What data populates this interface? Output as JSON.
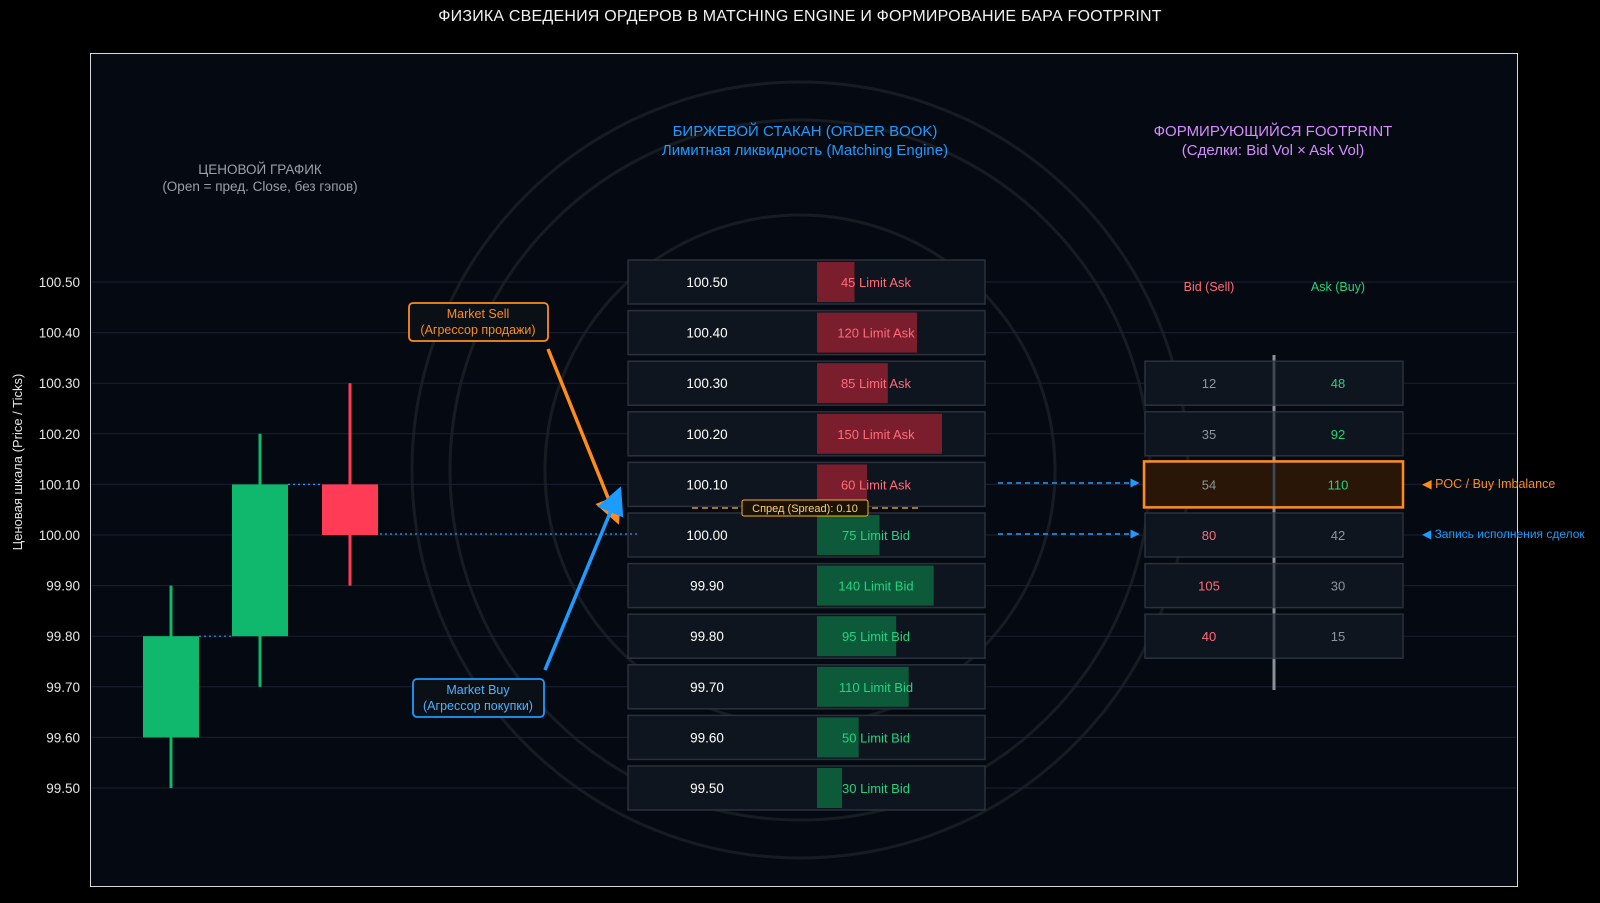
{
  "title": "ФИЗИКА СВЕДЕНИЯ ОРДЕРОВ В MATCHING ENGINE И ФОРМИРОВАНИЕ БАРА FOOTPRINT",
  "y_axis_label": "Ценовая шкала (Price / Ticks)",
  "price_levels": [
    "100.50",
    "100.40",
    "100.30",
    "100.20",
    "100.10",
    "100.00",
    "99.90",
    "99.80",
    "99.70",
    "99.60",
    "99.50"
  ],
  "price_chart": {
    "title": "ЦЕНОВОЙ ГРАФИК",
    "subtitle": "(Open = пред. Close, без гэпов)",
    "candles": [
      {
        "open": 99.6,
        "close": 99.8,
        "high": 99.9,
        "low": 99.5,
        "dir": "up"
      },
      {
        "open": 99.8,
        "close": 100.1,
        "high": 100.2,
        "low": 99.7,
        "dir": "up"
      },
      {
        "open": 100.1,
        "close": 100.0,
        "high": 100.3,
        "low": 99.9,
        "dir": "down"
      }
    ]
  },
  "order_book": {
    "title": "БИРЖЕВОЙ СТАКАН (ORDER BOOK)",
    "subtitle": "Лимитная ликвидность (Matching Engine)",
    "rows": [
      {
        "price": "100.50",
        "volume": 45,
        "label": "45 Limit Ask",
        "side": "ask"
      },
      {
        "price": "100.40",
        "volume": 120,
        "label": "120 Limit Ask",
        "side": "ask"
      },
      {
        "price": "100.30",
        "volume": 85,
        "label": "85 Limit Ask",
        "side": "ask"
      },
      {
        "price": "100.20",
        "volume": 150,
        "label": "150 Limit Ask",
        "side": "ask"
      },
      {
        "price": "100.10",
        "volume": 60,
        "label": "60 Limit Ask",
        "side": "ask"
      },
      {
        "price": "100.00",
        "volume": 75,
        "label": "75 Limit Bid",
        "side": "bid"
      },
      {
        "price": "99.90",
        "volume": 140,
        "label": "140 Limit Bid",
        "side": "bid"
      },
      {
        "price": "99.80",
        "volume": 95,
        "label": "95 Limit Bid",
        "side": "bid"
      },
      {
        "price": "99.70",
        "volume": 110,
        "label": "110 Limit Bid",
        "side": "bid"
      },
      {
        "price": "99.60",
        "volume": 50,
        "label": "50 Limit Bid",
        "side": "bid"
      },
      {
        "price": "99.50",
        "volume": 30,
        "label": "30 Limit Bid",
        "side": "bid"
      }
    ],
    "spread_label": "Спред (Spread): 0.10"
  },
  "aggressors": {
    "sell": {
      "line1": "Market Sell",
      "line2": "(Агрессор продажи)"
    },
    "buy": {
      "line1": "Market Buy",
      "line2": "(Агрессор покупки)"
    }
  },
  "footprint": {
    "title": "ФОРМИРУЮЩИЙСЯ FOOTPRINT",
    "subtitle": "(Сделки: Bid Vol × Ask Vol)",
    "bid_header": "Bid (Sell)",
    "ask_header": "Ask (Buy)",
    "rows": [
      {
        "price": "100.30",
        "bid": "12",
        "ask": "48",
        "bid_hl": false,
        "ask_hl": true
      },
      {
        "price": "100.20",
        "bid": "35",
        "ask": "92",
        "bid_hl": false,
        "ask_hl": true
      },
      {
        "price": "100.10",
        "bid": "54",
        "ask": "110",
        "bid_hl": false,
        "ask_hl": true,
        "poc": true
      },
      {
        "price": "100.00",
        "bid": "80",
        "ask": "42",
        "bid_hl": true,
        "ask_hl": false
      },
      {
        "price": "99.90",
        "bid": "105",
        "ask": "30",
        "bid_hl": true,
        "ask_hl": false
      },
      {
        "price": "99.80",
        "bid": "40",
        "ask": "15",
        "bid_hl": true,
        "ask_hl": false
      }
    ],
    "poc_label": "◀ POC / Buy Imbalance",
    "exec_label": "◀ Запись исполнения сделок"
  },
  "colors": {
    "up": "#0fb86c",
    "down": "#ff3b55",
    "ask_bar": "#7a1e2e",
    "bid_bar": "#0c5a3a",
    "ask_text": "#ff6b78",
    "bid_text": "#22d47f",
    "orange": "#ff8c1a",
    "blue": "#1e9bff",
    "purple": "#d58cff"
  }
}
